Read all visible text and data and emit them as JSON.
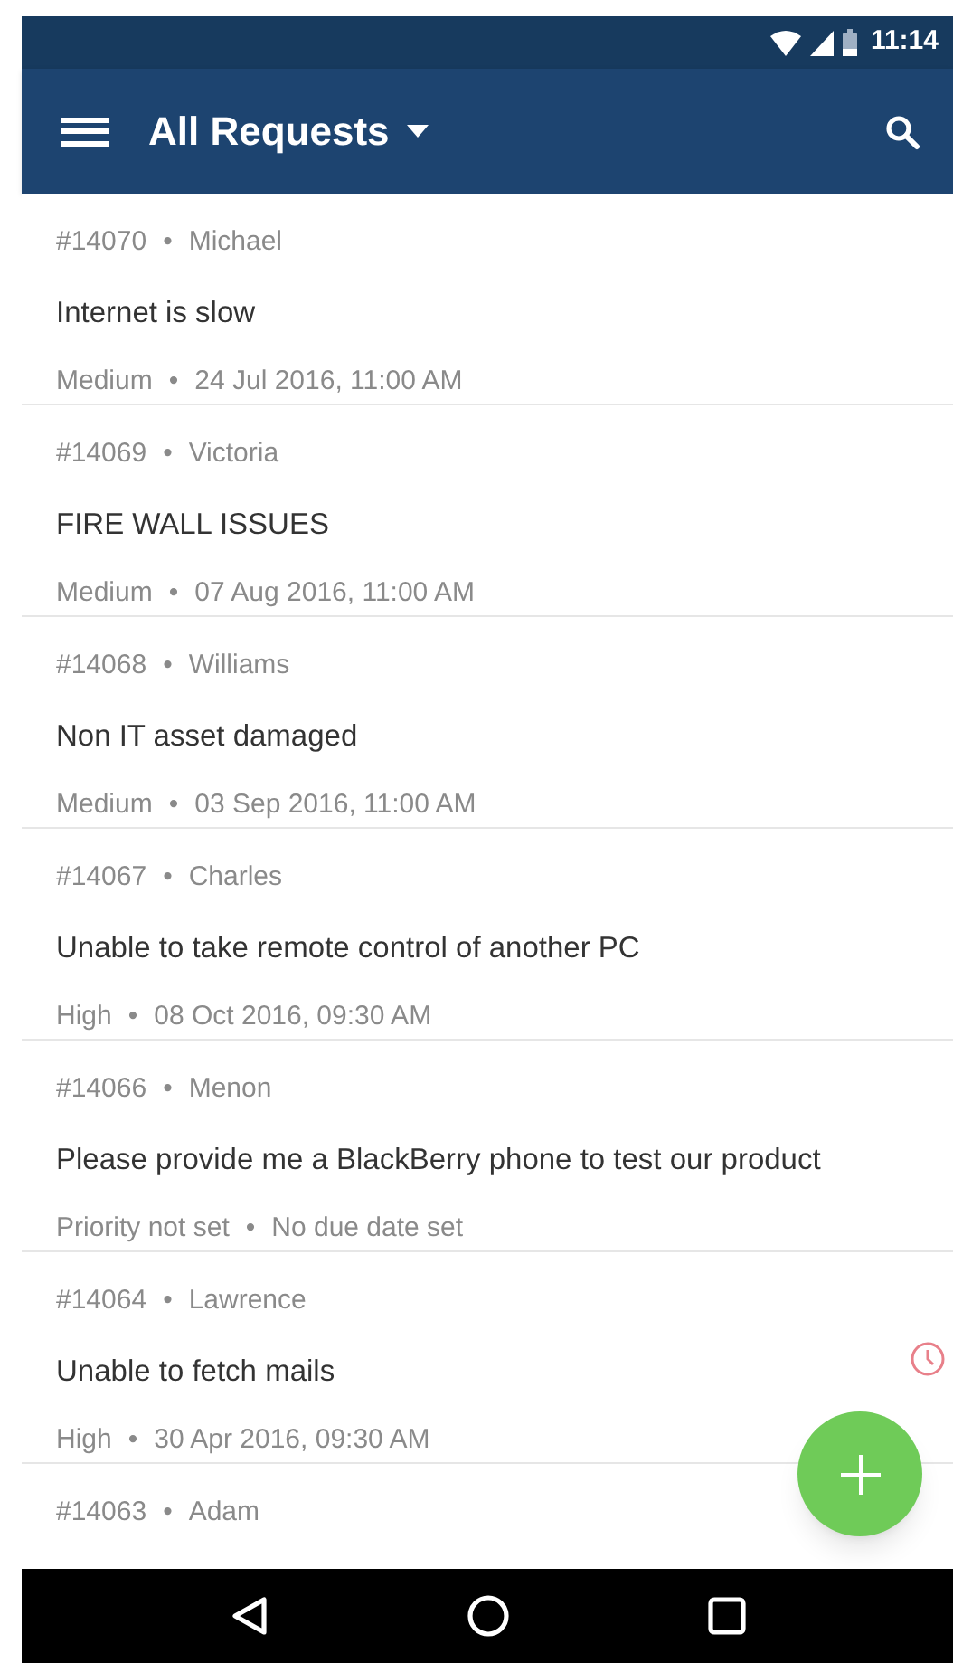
{
  "status_bar": {
    "time": "11:14"
  },
  "toolbar": {
    "title": "All Requests"
  },
  "requests": [
    {
      "header": [
        "#14070",
        "•",
        "Michael"
      ],
      "title": "Internet is slow",
      "meta": [
        "Medium",
        "•",
        "24 Jul 2016, 11:00 AM"
      ],
      "overdue": false
    },
    {
      "header": [
        "#14069",
        "•",
        "Victoria"
      ],
      "title": "FIRE WALL ISSUES",
      "meta": [
        "Medium",
        "•",
        "07 Aug 2016, 11:00 AM"
      ],
      "overdue": false
    },
    {
      "header": [
        "#14068",
        "•",
        "Williams"
      ],
      "title": "Non IT asset damaged",
      "meta": [
        "Medium",
        "•",
        "03 Sep 2016, 11:00 AM"
      ],
      "overdue": false
    },
    {
      "header": [
        "#14067",
        "•",
        "Charles"
      ],
      "title": "Unable to take remote control of another PC",
      "meta": [
        "High",
        "•",
        "08 Oct 2016, 09:30 AM"
      ],
      "overdue": false
    },
    {
      "header": [
        "#14066",
        "•",
        "Menon"
      ],
      "title": "Please provide me a BlackBerry phone to test our product",
      "meta": [
        "Priority not set",
        "•",
        "No due date set"
      ],
      "overdue": false
    },
    {
      "header": [
        "#14064",
        "•",
        "Lawrence"
      ],
      "title": "Unable to fetch mails",
      "meta": [
        "High",
        "•",
        "30 Apr 2016, 09:30 AM"
      ],
      "overdue": true
    },
    {
      "header": [
        "#14063",
        "•",
        "Adam"
      ],
      "overdue": false
    }
  ]
}
